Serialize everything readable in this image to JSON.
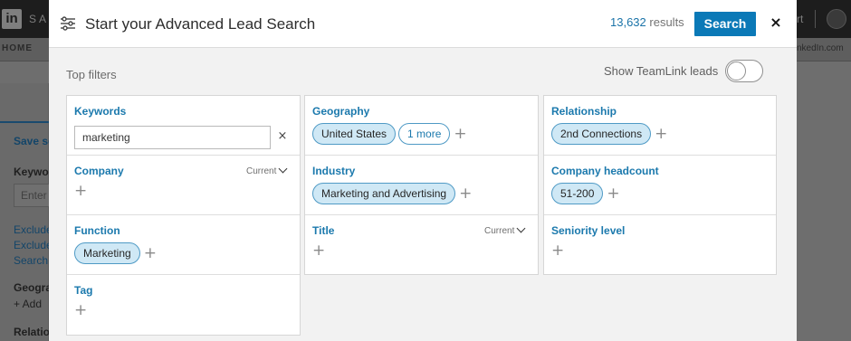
{
  "background": {
    "brand": "SA",
    "nav_home": "HOME",
    "right_text": "rt",
    "right_url": "nkedIn.com",
    "left_items": [
      "Save se",
      "Keywo",
      "Exclude",
      "Exclude",
      "Search",
      "Geogra",
      "+ Add",
      "Relatio"
    ],
    "left_input_placeholder": "Enter"
  },
  "modal": {
    "title": "Start your Advanced Lead Search",
    "results_count": "13,632",
    "results_label": "results",
    "search_button": "Search",
    "close": "×",
    "top_filters_label": "Top filters",
    "teamlink_label": "Show TeamLink leads",
    "teamlink_on": false
  },
  "filters": {
    "keywords": {
      "title": "Keywords",
      "value": "marketing",
      "clear": "×"
    },
    "company": {
      "title": "Company",
      "current": "Current"
    },
    "function": {
      "title": "Function",
      "chips": [
        "Marketing"
      ]
    },
    "tag": {
      "title": "Tag"
    },
    "geography": {
      "title": "Geography",
      "chips": [
        "United States"
      ],
      "more": "1 more"
    },
    "industry": {
      "title": "Industry",
      "chips": [
        "Marketing and Advertising"
      ]
    },
    "title": {
      "title": "Title",
      "current": "Current"
    },
    "relationship": {
      "title": "Relationship",
      "chips": [
        "2nd Connections"
      ]
    },
    "headcount": {
      "title": "Company headcount",
      "chips": [
        "51-200"
      ]
    },
    "seniority": {
      "title": "Seniority level"
    }
  },
  "icons": {
    "filter": "sliders-icon",
    "add": "plus-icon",
    "close": "close-icon",
    "chevron": "chevron-down-icon"
  },
  "colors": {
    "accent": "#0b79b7",
    "link": "#1b79ad",
    "chip_bg": "#cfe8f5"
  }
}
